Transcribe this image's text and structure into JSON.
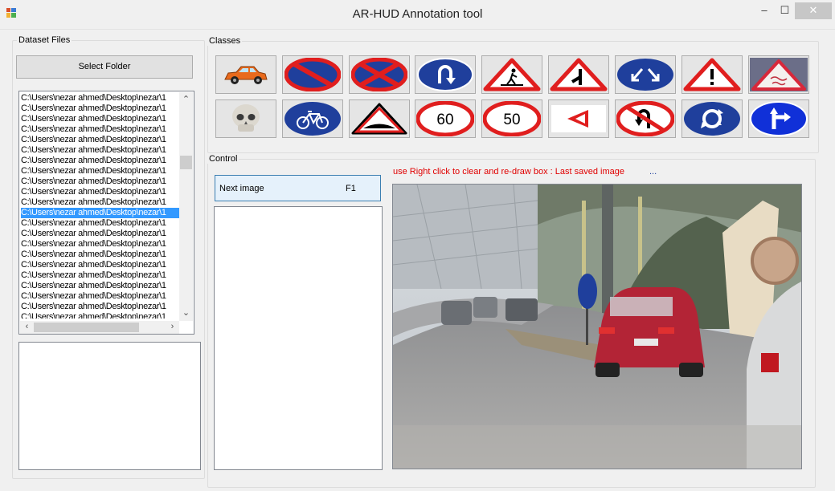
{
  "window": {
    "title": "AR-HUD Annotation tool",
    "minimize": "–",
    "maximize": "☐",
    "close": "✕"
  },
  "dataset": {
    "group_label": "Dataset Files",
    "select_folder_label": "Select Folder",
    "files": [
      "C:\\Users\\nezar ahmed\\Desktop\\nezar\\1",
      "C:\\Users\\nezar ahmed\\Desktop\\nezar\\1",
      "C:\\Users\\nezar ahmed\\Desktop\\nezar\\1",
      "C:\\Users\\nezar ahmed\\Desktop\\nezar\\1",
      "C:\\Users\\nezar ahmed\\Desktop\\nezar\\1",
      "C:\\Users\\nezar ahmed\\Desktop\\nezar\\1",
      "C:\\Users\\nezar ahmed\\Desktop\\nezar\\1",
      "C:\\Users\\nezar ahmed\\Desktop\\nezar\\1",
      "C:\\Users\\nezar ahmed\\Desktop\\nezar\\1",
      "C:\\Users\\nezar ahmed\\Desktop\\nezar\\1",
      "C:\\Users\\nezar ahmed\\Desktop\\nezar\\1",
      "C:\\Users\\nezar ahmed\\Desktop\\nezar\\1",
      "C:\\Users\\nezar ahmed\\Desktop\\nezar\\1",
      "C:\\Users\\nezar ahmed\\Desktop\\nezar\\1",
      "C:\\Users\\nezar ahmed\\Desktop\\nezar\\1",
      "C:\\Users\\nezar ahmed\\Desktop\\nezar\\1",
      "C:\\Users\\nezar ahmed\\Desktop\\nezar\\1",
      "C:\\Users\\nezar ahmed\\Desktop\\nezar\\1",
      "C:\\Users\\nezar ahmed\\Desktop\\nezar\\1",
      "C:\\Users\\nezar ahmed\\Desktop\\nezar\\1",
      "C:\\Users\\nezar ahmed\\Desktop\\nezar\\1",
      "C:\\Users\\nezar ahmed\\Desktop\\nezar\\1"
    ],
    "selected_index": 11
  },
  "classes": {
    "group_label": "Classes",
    "row1": [
      "car-icon",
      "no-parking-sign-icon",
      "no-stopping-sign-icon",
      "u-turn-sign-icon",
      "pedestrian-crossing-sign-icon",
      "junction-warning-sign-icon",
      "diverge-arrows-sign-icon",
      "general-warning-sign-icon",
      "arabic-text-warning-sign-icon"
    ],
    "row2": [
      "skull-icon",
      "bicycle-sign-icon",
      "speed-bump-sign-icon",
      "speed-limit-sign-icon",
      "speed-limit-sign-icon",
      "chevron-left-sign-icon",
      "no-u-turn-sign-icon",
      "roundabout-sign-icon",
      "turn-right-sign-icon"
    ],
    "speed_60": "60",
    "speed_50": "50"
  },
  "control": {
    "group_label": "Control",
    "next_image_label": "Next image",
    "next_image_shortcut": "F1",
    "hint": "use Right click to clear and re-draw box : Last saved image",
    "last_saved": "..."
  },
  "colors": {
    "sign_red": "#e01e1e",
    "sign_blue": "#1f3f9c",
    "hint_red": "#e00000",
    "selection": "#3399ff"
  }
}
